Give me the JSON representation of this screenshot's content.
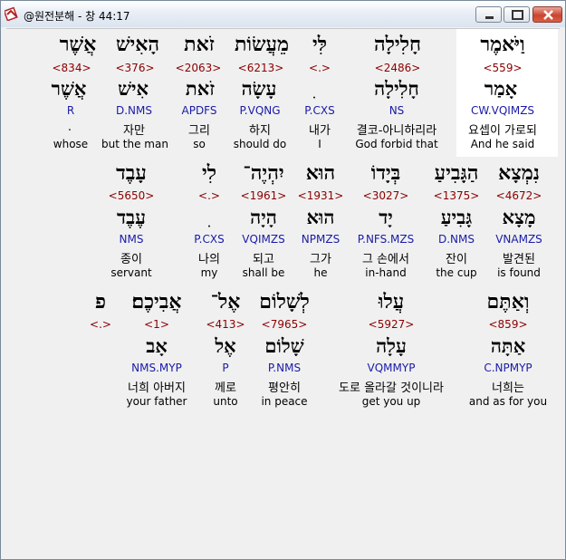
{
  "window": {
    "title": "@원전분해 - 창 44:17",
    "minimize_icon": "minimize-icon",
    "maximize_icon": "maximize-icon",
    "close_icon": "close-icon"
  },
  "rows": [
    {
      "words": [
        {
          "heb": "אֲשֶׁר",
          "strong": "<834>",
          "lex": "אֲשֶׁר",
          "morph": "R",
          "kor": ".",
          "eng": "whose"
        },
        {
          "heb": "הָאִישׁ",
          "strong": "<376>",
          "lex": "אִישׁ",
          "morph": "D.NMS",
          "kor": "자만",
          "eng": "but the man"
        },
        {
          "heb": "זֹאת",
          "strong": "<2063>",
          "lex": "זֹאת",
          "morph": "APDFS",
          "kor": "그리",
          "eng": "so"
        },
        {
          "heb": "מֵעֲשׂוֹת",
          "strong": "<6213>",
          "lex": "עָשָׂה",
          "morph": "P.VQNG",
          "kor": "하지",
          "eng": "should do"
        },
        {
          "heb": "לִּי",
          "strong": "<.>",
          "lex": "ִ",
          "morph": "P.CXS",
          "kor": "내가",
          "eng": "I"
        },
        {
          "heb": "חָלִילָה",
          "strong": "<2486>",
          "lex": "חָלִילָה",
          "morph": "NS",
          "kor": "결코-아니하리라",
          "eng": "God forbid that"
        },
        {
          "heb": "וַיֹּאמֶר",
          "strong": "<559>",
          "lex": "אָמַר",
          "morph": "CW.VQIMZS",
          "kor": "요셉이 가로되",
          "eng": "And he said"
        }
      ]
    },
    {
      "words": [
        {
          "heb": "עָבֶד",
          "strong": "<5650>",
          "lex": "עֶבֶד",
          "morph": "NMS",
          "kor": "종이",
          "eng": "servant"
        },
        {
          "heb": "לִי",
          "strong": "<.>",
          "lex": "ִ",
          "morph": "P.CXS",
          "kor": "나의",
          "eng": "my"
        },
        {
          "heb": "יִהְיֶה־",
          "strong": "<1961>",
          "lex": "הָיָה",
          "morph": "VQIMZS",
          "kor": "되고",
          "eng": "shall be"
        },
        {
          "heb": "הוּא",
          "strong": "<1931>",
          "lex": "הוּא",
          "morph": "NPMZS",
          "kor": "그가",
          "eng": "he"
        },
        {
          "heb": "בְּיָדוֹ",
          "strong": "<3027>",
          "lex": "יָד",
          "morph": "P.NFS.MZS",
          "kor": "그 손에서",
          "eng": "in-hand"
        },
        {
          "heb": "הַגָּבִיעַ",
          "strong": "<1375>",
          "lex": "גָּבִיעַ",
          "morph": "D.NMS",
          "kor": "잔이",
          "eng": "the cup"
        },
        {
          "heb": "נִמְצָא",
          "strong": "<4672>",
          "lex": "מָצָא",
          "morph": "VNAMZS",
          "kor": "발견된",
          "eng": "is found"
        }
      ]
    },
    {
      "words": [
        {
          "heb": "פ",
          "strong": "<.>",
          "lex": "",
          "morph": "",
          "kor": "",
          "eng": ""
        },
        {
          "heb": "אֲבִיכֶם׃",
          "strong": "<1>",
          "lex": "אָב",
          "morph": "NMS.MYP",
          "kor": "너희 아버지",
          "eng": "your father"
        },
        {
          "heb": "אֶל־",
          "strong": "<413>",
          "lex": "אֶל",
          "morph": "P",
          "kor": "께로",
          "eng": "unto"
        },
        {
          "heb": "לְשָׁלוֹם",
          "strong": "<7965>",
          "lex": "שָׁלוֹם",
          "morph": "P.NMS",
          "kor": "평안히",
          "eng": "in peace"
        },
        {
          "heb": "עֲלוּ",
          "strong": "<5927>",
          "lex": "עָלָה",
          "morph": "VQMMYP",
          "kor": "도로 올라갈 것이니라",
          "eng": "get you up"
        },
        {
          "heb": "וְאַתֶּם",
          "strong": "<859>",
          "lex": "אַתָּה",
          "morph": "C.NPMYP",
          "kor": "너희는",
          "eng": "and as for you"
        }
      ]
    }
  ]
}
